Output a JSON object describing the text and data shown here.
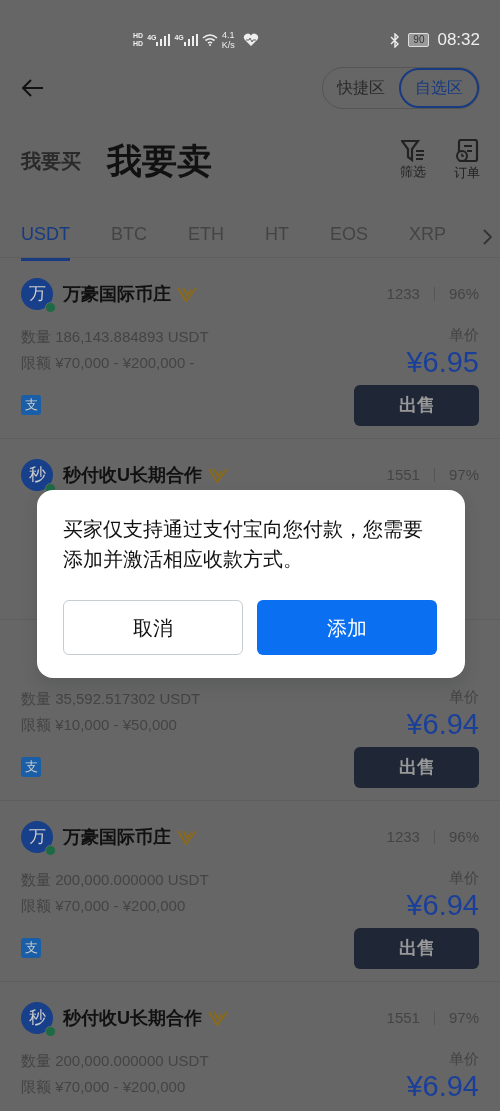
{
  "status_bar": {
    "sim_labels": [
      "HD",
      "HD"
    ],
    "network_labels": [
      "4G",
      "4G"
    ],
    "speed_value": "4.1",
    "speed_unit": "K/s",
    "battery": "90",
    "time": "08:32"
  },
  "segments": [
    {
      "label": "快捷区",
      "selected": false
    },
    {
      "label": "自选区",
      "selected": true
    }
  ],
  "mode_tabs": [
    {
      "label": "我要买",
      "selected": false
    },
    {
      "label": "我要卖",
      "selected": true
    }
  ],
  "actions": [
    {
      "label": "筛选",
      "kind": "filter"
    },
    {
      "label": "订单",
      "kind": "orders"
    }
  ],
  "coin_tabs": [
    {
      "label": "USDT",
      "selected": true
    },
    {
      "label": "BTC",
      "selected": false
    },
    {
      "label": "ETH",
      "selected": false
    },
    {
      "label": "HT",
      "selected": false
    },
    {
      "label": "EOS",
      "selected": false
    },
    {
      "label": "XRP",
      "selected": false
    }
  ],
  "listings": [
    {
      "avatar": "万",
      "online": true,
      "name": "万豪国际币庄",
      "verified": true,
      "trades": "1233",
      "completion": "96%",
      "quantity_label": "数量",
      "quantity": "186,143.884893 USDT",
      "limit_label": "限额",
      "limit": "¥70,000 - ¥200,000 -",
      "price_label": "单价",
      "price": "¥6.95",
      "payment": "支",
      "action": "出售"
    },
    {
      "avatar": "秒",
      "online": true,
      "name": "秒付收U长期合作",
      "verified": true,
      "trades": "1551",
      "completion": "97%"
    },
    {
      "quantity_label": "数量",
      "quantity": "35,592.517302 USDT",
      "limit_label": "限额",
      "limit": "¥10,000 - ¥50,000",
      "price_label": "单价",
      "price": "¥6.94",
      "payment": "支",
      "action": "出售"
    },
    {
      "avatar": "万",
      "online": true,
      "name": "万豪国际币庄",
      "verified": true,
      "trades": "1233",
      "completion": "96%",
      "quantity_label": "数量",
      "quantity": "200,000.000000 USDT",
      "limit_label": "限额",
      "limit": "¥70,000 - ¥200,000",
      "price_label": "单价",
      "price": "¥6.94",
      "payment": "支",
      "action": "出售"
    },
    {
      "avatar": "秒",
      "online": true,
      "name": "秒付收U长期合作",
      "verified": true,
      "trades": "1551",
      "completion": "97%",
      "quantity_label": "数量",
      "quantity": "200,000.000000 USDT",
      "limit_label": "限额",
      "limit": "¥70,000 - ¥200,000",
      "price_label": "单价",
      "price": "¥6.94"
    }
  ],
  "dialog": {
    "message": "买家仅支持通过支付宝向您付款，您需要添加并激活相应收款方式。",
    "buttons": [
      {
        "label": "取消",
        "kind": "secondary"
      },
      {
        "label": "添加",
        "kind": "primary"
      }
    ]
  }
}
